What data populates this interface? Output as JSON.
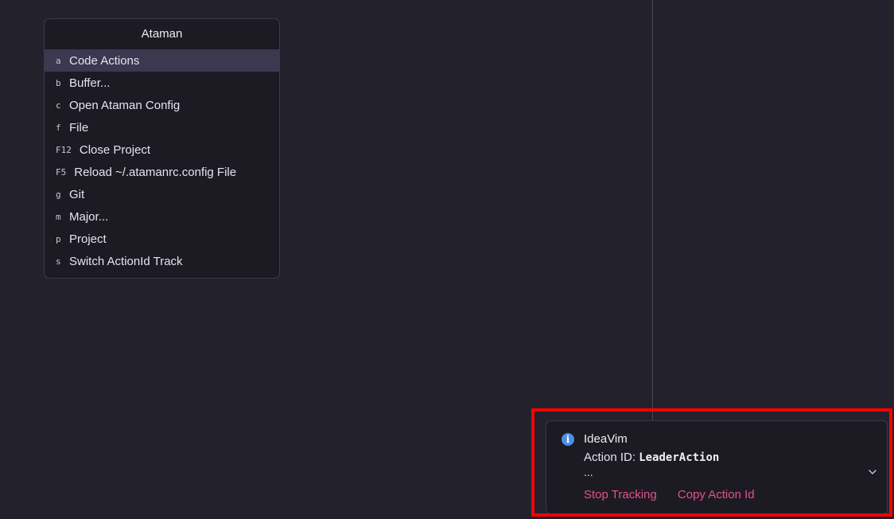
{
  "popup": {
    "title": "Ataman",
    "items": [
      {
        "key": "a",
        "label": "Code Actions",
        "selected": true
      },
      {
        "key": "b",
        "label": "Buffer..."
      },
      {
        "key": "c",
        "label": "Open Ataman Config"
      },
      {
        "key": "f",
        "label": "File"
      },
      {
        "key": "F12",
        "label": "Close Project"
      },
      {
        "key": "F5",
        "label": "Reload ~/.atamanrc.config File"
      },
      {
        "key": "g",
        "label": "Git"
      },
      {
        "key": "m",
        "label": "Major..."
      },
      {
        "key": "p",
        "label": "Project"
      },
      {
        "key": "s",
        "label": "Switch ActionId Track"
      }
    ]
  },
  "notification": {
    "icon": "info-icon",
    "title": "IdeaVim",
    "body_prefix": "Action ID: ",
    "action_id": "LeaderAction",
    "ellipsis": "...",
    "actions": {
      "stop": "Stop Tracking",
      "copy": "Copy Action Id"
    },
    "expand_icon": "chevron-down-icon"
  },
  "colors": {
    "background": "#22212c",
    "selection": "#3b3850",
    "link": "#e0528a",
    "info": "#4c8fe6",
    "highlight": "#ff0000"
  }
}
